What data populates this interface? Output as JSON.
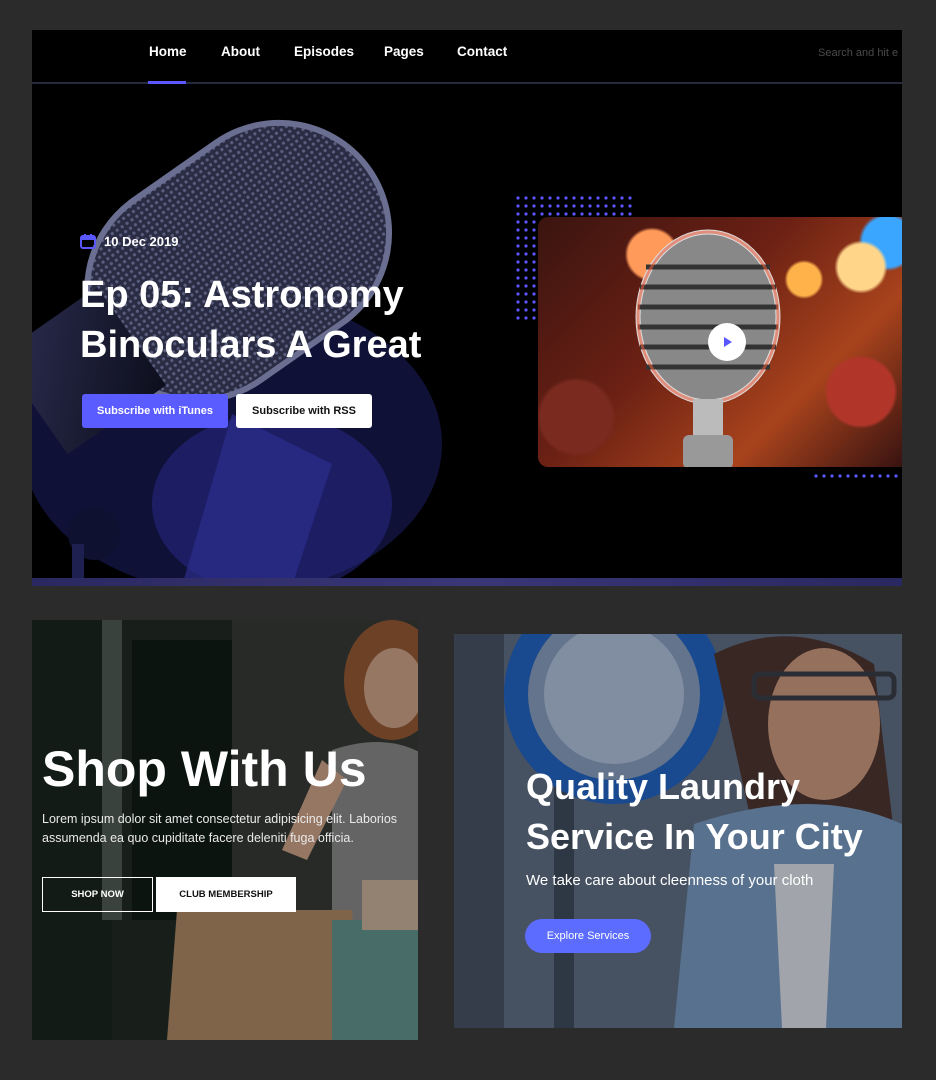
{
  "podcast": {
    "nav": {
      "items": [
        "Home",
        "About",
        "Episodes",
        "Pages",
        "Contact"
      ],
      "search_placeholder": "Search and hit e"
    },
    "date": "10 Dec 2019",
    "title_line1": "Ep 05: Astronomy",
    "title_line2": "Binoculars A Great",
    "btn_itunes": "Subscribe with iTunes",
    "btn_rss": "Subscribe with RSS",
    "accent": "#5a5cff"
  },
  "shop": {
    "title": "Shop With Us",
    "desc_line1": "Lorem ipsum dolor sit amet consectetur adipisicing elit. Laborios",
    "desc_line2": "assumenda ea quo cupiditate facere deleniti fuga officia.",
    "btn_shop": "SHOP NOW",
    "btn_club": "CLUB MEMBERSHIP"
  },
  "laundry": {
    "title_line1": "Quality Laundry",
    "title_line2": "Service In Your City",
    "subtitle": "We take care about cleenness of your cloth",
    "btn_explore": "Explore Services",
    "accent": "#5b6cff"
  }
}
